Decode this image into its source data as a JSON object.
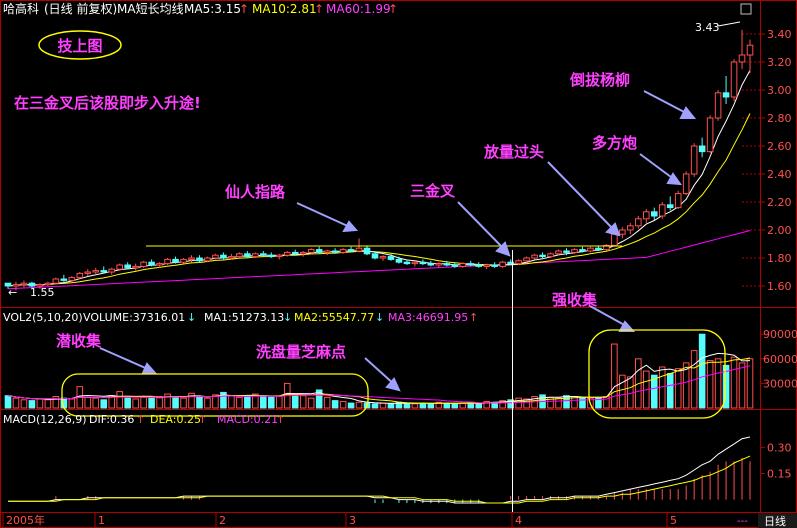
{
  "colors": {
    "bg": "#000000",
    "up": "#ff5050",
    "down": "#54fcfc",
    "ma5": "#ffffff",
    "ma10": "#ffff00",
    "ma60": "#ff00ff",
    "grid": "#b00000",
    "axis": "#b00000",
    "annotation": "#ff40ff",
    "arrow": "#a0a0ff",
    "label_text": "#c8c8c8"
  },
  "header": {
    "stock_name": "哈高科",
    "period": "(日线 前复权)",
    "indicator": "MA短长均线",
    "ma5": "MA5:3.15",
    "ma10": "MA10:2.81",
    "ma60": "MA60:1.99",
    "ma5_arrow": "↑",
    "ma10_arrow": "↑",
    "ma60_arrow": "↑"
  },
  "volume_header": {
    "name": "VOL2(5,10,20)",
    "volume": "VOLUME:37316.01",
    "volume_arrow": "↓",
    "ma1": "MA1:51273.13",
    "ma1_arrow": "↓",
    "ma2": "MA2:55547.77",
    "ma2_arrow": "↓",
    "ma3": "MA3:46691.95",
    "ma3_arrow": "↑"
  },
  "macd_header": {
    "name": "MACD(12,26,9)",
    "dif": "DIF:0.36",
    "dif_arrow": "↑",
    "dea": "DEA:0.25",
    "dea_arrow": "↑",
    "macd": "MACD:0.21",
    "macd_arrow": "↑"
  },
  "annotations": {
    "title_oval": "技上图",
    "main_note": "在三金叉后该股即步入升途!",
    "xianren": "仙人指路",
    "sanjincha": "三金叉",
    "fangliang": "放量过头",
    "duofang": "多方炮",
    "daoba": "倒拔杨柳",
    "qiangshouji": "强收集",
    "qianshouji": "潜收集",
    "xipan": "洗盘量芝麻点",
    "high_label": "3.43",
    "low_label": "1.55"
  },
  "price_axis": [
    "3.40",
    "3.20",
    "3.00",
    "2.80",
    "2.60",
    "2.40",
    "2.20",
    "2.00",
    "1.80",
    "1.60"
  ],
  "volume_axis": [
    "90000",
    "60000",
    "30000"
  ],
  "macd_axis": [
    "0.30",
    "0.15"
  ],
  "time_axis": [
    "2005年",
    "1",
    "2",
    "3",
    "4",
    "5"
  ],
  "footer": {
    "dots": "---",
    "period_label": "日线"
  },
  "chart_data": {
    "type": "candlestick",
    "price_ylim": [
      1.5,
      3.5
    ],
    "volume_ylim": [
      0,
      100000
    ],
    "macd_ylim": [
      -0.06,
      0.4
    ],
    "candles": [
      [
        1.62,
        1.62,
        1.58,
        1.6
      ],
      [
        1.6,
        1.63,
        1.57,
        1.61
      ],
      [
        1.61,
        1.64,
        1.59,
        1.62
      ],
      [
        1.62,
        1.63,
        1.59,
        1.6
      ],
      [
        1.6,
        1.62,
        1.58,
        1.61
      ],
      [
        1.61,
        1.63,
        1.6,
        1.62
      ],
      [
        1.62,
        1.66,
        1.61,
        1.65
      ],
      [
        1.65,
        1.68,
        1.63,
        1.64
      ],
      [
        1.64,
        1.67,
        1.63,
        1.66
      ],
      [
        1.66,
        1.7,
        1.65,
        1.69
      ],
      [
        1.69,
        1.72,
        1.67,
        1.7
      ],
      [
        1.7,
        1.73,
        1.68,
        1.71
      ],
      [
        1.71,
        1.74,
        1.69,
        1.7
      ],
      [
        1.7,
        1.73,
        1.68,
        1.72
      ],
      [
        1.72,
        1.76,
        1.71,
        1.75
      ],
      [
        1.75,
        1.77,
        1.72,
        1.73
      ],
      [
        1.73,
        1.76,
        1.71,
        1.74
      ],
      [
        1.74,
        1.78,
        1.73,
        1.77
      ],
      [
        1.77,
        1.79,
        1.74,
        1.75
      ],
      [
        1.75,
        1.77,
        1.73,
        1.76
      ],
      [
        1.76,
        1.8,
        1.75,
        1.79
      ],
      [
        1.79,
        1.81,
        1.76,
        1.77
      ],
      [
        1.77,
        1.8,
        1.76,
        1.79
      ],
      [
        1.79,
        1.82,
        1.77,
        1.8
      ],
      [
        1.8,
        1.82,
        1.77,
        1.78
      ],
      [
        1.78,
        1.81,
        1.77,
        1.8
      ],
      [
        1.8,
        1.83,
        1.79,
        1.82
      ],
      [
        1.82,
        1.84,
        1.79,
        1.8
      ],
      [
        1.8,
        1.83,
        1.79,
        1.81
      ],
      [
        1.81,
        1.84,
        1.8,
        1.83
      ],
      [
        1.83,
        1.85,
        1.8,
        1.81
      ],
      [
        1.81,
        1.84,
        1.8,
        1.83
      ],
      [
        1.83,
        1.85,
        1.81,
        1.82
      ],
      [
        1.82,
        1.84,
        1.8,
        1.81
      ],
      [
        1.81,
        1.83,
        1.79,
        1.82
      ],
      [
        1.82,
        1.85,
        1.81,
        1.84
      ],
      [
        1.84,
        1.86,
        1.82,
        1.83
      ],
      [
        1.83,
        1.85,
        1.81,
        1.84
      ],
      [
        1.84,
        1.87,
        1.83,
        1.86
      ],
      [
        1.86,
        1.88,
        1.83,
        1.84
      ],
      [
        1.84,
        1.86,
        1.82,
        1.85
      ],
      [
        1.85,
        1.87,
        1.83,
        1.84
      ],
      [
        1.84,
        1.87,
        1.83,
        1.86
      ],
      [
        1.86,
        1.88,
        1.84,
        1.85
      ],
      [
        1.85,
        1.94,
        1.84,
        1.87
      ],
      [
        1.87,
        1.89,
        1.82,
        1.83
      ],
      [
        1.83,
        1.85,
        1.79,
        1.8
      ],
      [
        1.8,
        1.82,
        1.78,
        1.81
      ],
      [
        1.81,
        1.83,
        1.78,
        1.79
      ],
      [
        1.79,
        1.81,
        1.76,
        1.77
      ],
      [
        1.77,
        1.79,
        1.75,
        1.76
      ],
      [
        1.76,
        1.78,
        1.74,
        1.77
      ],
      [
        1.77,
        1.79,
        1.75,
        1.76
      ],
      [
        1.76,
        1.78,
        1.74,
        1.75
      ],
      [
        1.75,
        1.77,
        1.73,
        1.76
      ],
      [
        1.76,
        1.78,
        1.74,
        1.75
      ],
      [
        1.75,
        1.77,
        1.73,
        1.74
      ],
      [
        1.74,
        1.77,
        1.73,
        1.76
      ],
      [
        1.76,
        1.78,
        1.74,
        1.75
      ],
      [
        1.75,
        1.77,
        1.73,
        1.74
      ],
      [
        1.74,
        1.76,
        1.72,
        1.75
      ],
      [
        1.75,
        1.77,
        1.73,
        1.74
      ],
      [
        1.74,
        1.78,
        1.73,
        1.77
      ],
      [
        1.77,
        1.79,
        1.75,
        1.76
      ],
      [
        1.76,
        1.79,
        1.75,
        1.78
      ],
      [
        1.78,
        1.81,
        1.77,
        1.8
      ],
      [
        1.8,
        1.83,
        1.79,
        1.82
      ],
      [
        1.82,
        1.84,
        1.8,
        1.81
      ],
      [
        1.81,
        1.84,
        1.8,
        1.83
      ],
      [
        1.83,
        1.86,
        1.82,
        1.85
      ],
      [
        1.85,
        1.87,
        1.82,
        1.84
      ],
      [
        1.84,
        1.87,
        1.83,
        1.86
      ],
      [
        1.86,
        1.88,
        1.84,
        1.85
      ],
      [
        1.85,
        1.88,
        1.84,
        1.87
      ],
      [
        1.87,
        1.89,
        1.85,
        1.86
      ],
      [
        1.86,
        1.9,
        1.85,
        1.89
      ],
      [
        1.89,
        1.99,
        1.88,
        1.97
      ],
      [
        1.97,
        2.02,
        1.94,
        2.0
      ],
      [
        2.0,
        2.05,
        1.97,
        2.03
      ],
      [
        2.03,
        2.1,
        2.01,
        2.08
      ],
      [
        2.08,
        2.15,
        2.05,
        2.13
      ],
      [
        2.13,
        2.16,
        2.07,
        2.1
      ],
      [
        2.1,
        2.2,
        2.08,
        2.18
      ],
      [
        2.18,
        2.24,
        2.14,
        2.16
      ],
      [
        2.16,
        2.28,
        2.15,
        2.26
      ],
      [
        2.26,
        2.42,
        2.25,
        2.4
      ],
      [
        2.4,
        2.62,
        2.38,
        2.6
      ],
      [
        2.6,
        2.66,
        2.52,
        2.56
      ],
      [
        2.56,
        2.82,
        2.55,
        2.8
      ],
      [
        2.8,
        3.0,
        2.78,
        2.98
      ],
      [
        2.98,
        3.1,
        2.9,
        2.95
      ],
      [
        2.95,
        3.22,
        2.92,
        3.2
      ],
      [
        3.2,
        3.43,
        3.15,
        3.25
      ],
      [
        3.25,
        3.36,
        3.12,
        3.32
      ]
    ],
    "volume": [
      15000,
      12000,
      10000,
      9000,
      11000,
      10000,
      14000,
      12000,
      11000,
      26000,
      13000,
      12000,
      10000,
      15000,
      20000,
      12000,
      11000,
      13000,
      12000,
      14000,
      17000,
      13000,
      12000,
      18000,
      14000,
      12000,
      16000,
      19000,
      15000,
      13000,
      14000,
      17000,
      15000,
      13000,
      14000,
      30000,
      16000,
      15000,
      12000,
      22000,
      13000,
      9000,
      8000,
      6000,
      7000,
      6000,
      5000,
      6000,
      5000,
      7000,
      6000,
      5000,
      6000,
      5000,
      7000,
      6000,
      5000,
      6000,
      7000,
      6000,
      8000,
      7000,
      9000,
      10000,
      12000,
      11000,
      14000,
      16000,
      13000,
      12000,
      15000,
      14000,
      13000,
      12000,
      12000,
      14000,
      78000,
      40000,
      38000,
      60000,
      45000,
      40000,
      50000,
      42000,
      48000,
      55000,
      70000,
      90000,
      58000,
      60000,
      52000,
      62000,
      55000,
      60000
    ],
    "dif": [
      -0.01,
      -0.01,
      -0.01,
      -0.01,
      -0.01,
      -0.01,
      0.0,
      0.0,
      0.0,
      0.0,
      0.01,
      0.01,
      0.01,
      0.01,
      0.01,
      0.01,
      0.01,
      0.01,
      0.01,
      0.01,
      0.01,
      0.01,
      0.02,
      0.02,
      0.02,
      0.02,
      0.02,
      0.02,
      0.02,
      0.02,
      0.02,
      0.02,
      0.02,
      0.02,
      0.02,
      0.02,
      0.02,
      0.02,
      0.02,
      0.02,
      0.02,
      0.02,
      0.02,
      0.02,
      0.02,
      0.02,
      0.01,
      0.01,
      0.01,
      0.0,
      0.0,
      0.0,
      -0.01,
      -0.01,
      -0.01,
      -0.01,
      -0.02,
      -0.02,
      -0.02,
      -0.02,
      -0.02,
      -0.02,
      -0.02,
      -0.01,
      -0.01,
      0.0,
      0.0,
      0.0,
      0.01,
      0.01,
      0.01,
      0.02,
      0.02,
      0.02,
      0.02,
      0.03,
      0.04,
      0.05,
      0.06,
      0.07,
      0.08,
      0.09,
      0.1,
      0.11,
      0.12,
      0.14,
      0.17,
      0.2,
      0.22,
      0.26,
      0.29,
      0.32,
      0.35,
      0.36
    ],
    "dea": [
      -0.01,
      -0.01,
      -0.01,
      -0.01,
      -0.01,
      -0.01,
      -0.01,
      0.0,
      0.0,
      0.0,
      0.0,
      0.0,
      0.01,
      0.01,
      0.01,
      0.01,
      0.01,
      0.01,
      0.01,
      0.01,
      0.01,
      0.01,
      0.01,
      0.01,
      0.01,
      0.02,
      0.02,
      0.02,
      0.02,
      0.02,
      0.02,
      0.02,
      0.02,
      0.02,
      0.02,
      0.02,
      0.02,
      0.02,
      0.02,
      0.02,
      0.02,
      0.02,
      0.02,
      0.02,
      0.02,
      0.02,
      0.02,
      0.02,
      0.01,
      0.01,
      0.01,
      0.01,
      0.0,
      0.0,
      0.0,
      0.0,
      -0.01,
      -0.01,
      -0.01,
      -0.01,
      -0.02,
      -0.02,
      -0.02,
      -0.02,
      -0.02,
      -0.01,
      -0.01,
      -0.01,
      0.0,
      0.0,
      0.0,
      0.01,
      0.01,
      0.01,
      0.01,
      0.02,
      0.02,
      0.03,
      0.03,
      0.04,
      0.05,
      0.06,
      0.07,
      0.08,
      0.09,
      0.1,
      0.11,
      0.13,
      0.14,
      0.16,
      0.18,
      0.21,
      0.23,
      0.25
    ]
  }
}
